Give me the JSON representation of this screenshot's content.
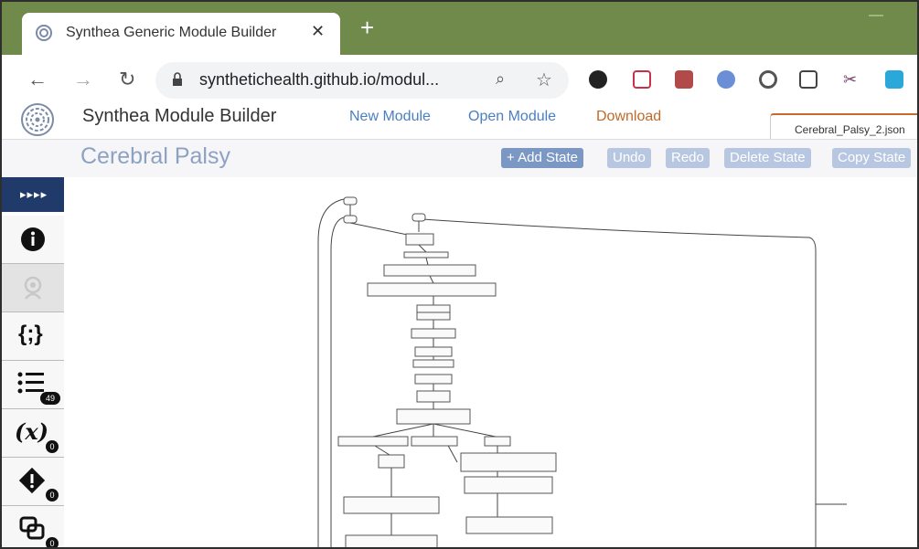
{
  "browser": {
    "tab_title": "Synthea Generic Module Builder",
    "tab_close": "✕",
    "new_tab": "+",
    "url": "synthetichealth.github.io/modul...",
    "icons": [
      "back-icon",
      "forward-icon",
      "reload-icon",
      "lock-icon",
      "zoom-icon",
      "star-icon"
    ],
    "extensions": [
      "e",
      "◘",
      "A",
      "O",
      "◎",
      "▦",
      "✂",
      "☁"
    ]
  },
  "app": {
    "name": "Synthea Module Builder",
    "menu": {
      "new": "New Module",
      "open": "Open Module",
      "download": "Download"
    },
    "file_tab": "Cerebral_Palsy_2.json"
  },
  "module": {
    "title": "Cerebral Palsy",
    "buttons": {
      "add": "+ Add State",
      "undo": "Undo",
      "redo": "Redo",
      "delete": "Delete State",
      "copy": "Copy State"
    }
  },
  "sidebar": {
    "collapse": "▸▸▸▸",
    "items": [
      {
        "icon": "info-icon",
        "glyph": "i"
      },
      {
        "icon": "synthea-icon",
        "glyph": ""
      },
      {
        "icon": "json-icon",
        "glyph": "{;}"
      },
      {
        "icon": "states-list-icon",
        "glyph": "≡",
        "badge": "49"
      },
      {
        "icon": "variables-icon",
        "glyph": "(x)",
        "badge": "0"
      },
      {
        "icon": "warning-icon",
        "glyph": "◆",
        "badge": "0"
      },
      {
        "icon": "submodules-icon",
        "glyph": "⧉",
        "badge": "0"
      }
    ]
  },
  "colors": {
    "tabstrip": "#6f8a4a",
    "primary_button": "#7b98c5",
    "disabled_button": "#b7c7e1",
    "sidebar_top": "#203a6a",
    "module_title": "#8da2c2"
  }
}
